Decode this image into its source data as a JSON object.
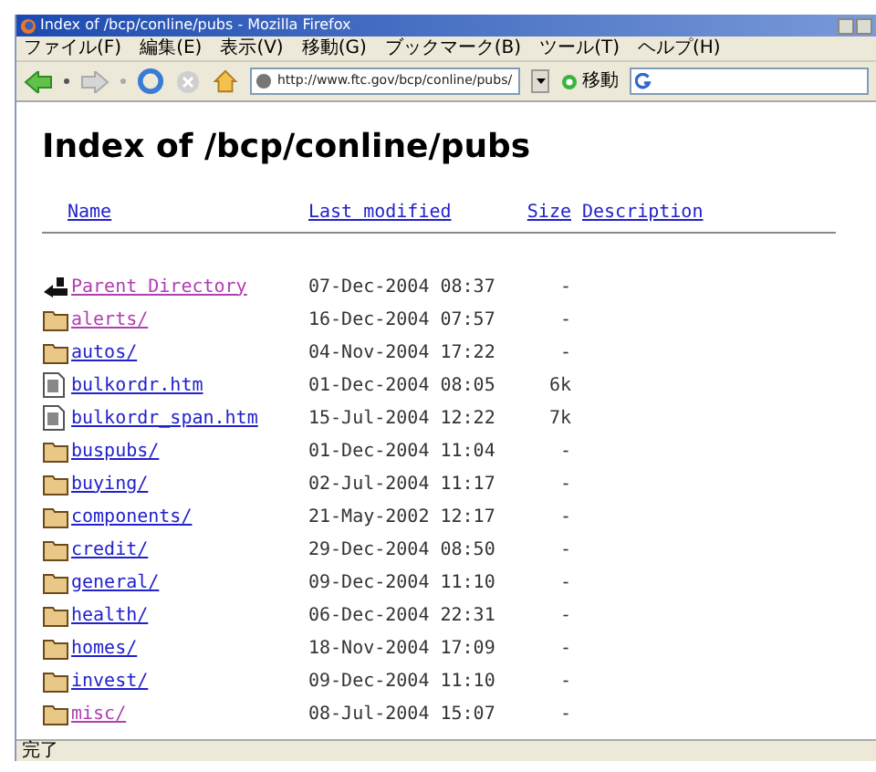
{
  "window": {
    "title": "Index of /bcp/conline/pubs - Mozilla Firefox"
  },
  "menu": [
    "ファイル(F)",
    "編集(E)",
    "表示(V)",
    "移動(G)",
    "ブックマーク(B)",
    "ツール(T)",
    "ヘルプ(H)"
  ],
  "toolbar": {
    "url": "http://www.ftc.gov/bcp/conline/pubs/",
    "go": "移動"
  },
  "heading": "Index of /bcp/conline/pubs",
  "columns": [
    "Name",
    "Last modified",
    "Size",
    "Description"
  ],
  "rows": [
    {
      "kind": "parent",
      "name": "Parent Directory",
      "modified": "07-Dec-2004 08:37",
      "size": "-",
      "visited": true
    },
    {
      "kind": "folder",
      "name": "alerts/",
      "modified": "16-Dec-2004 07:57",
      "size": "-",
      "visited": true
    },
    {
      "kind": "folder",
      "name": "autos/",
      "modified": "04-Nov-2004 17:22",
      "size": "-",
      "visited": false
    },
    {
      "kind": "file",
      "name": "bulkordr.htm",
      "modified": "01-Dec-2004 08:05",
      "size": "6k",
      "visited": false
    },
    {
      "kind": "file",
      "name": "bulkordr_span.htm",
      "modified": "15-Jul-2004 12:22",
      "size": "7k",
      "visited": false
    },
    {
      "kind": "folder",
      "name": "buspubs/",
      "modified": "01-Dec-2004 11:04",
      "size": "-",
      "visited": false
    },
    {
      "kind": "folder",
      "name": "buying/",
      "modified": "02-Jul-2004 11:17",
      "size": "-",
      "visited": false
    },
    {
      "kind": "folder",
      "name": "components/",
      "modified": "21-May-2002 12:17",
      "size": "-",
      "visited": false
    },
    {
      "kind": "folder",
      "name": "credit/",
      "modified": "29-Dec-2004 08:50",
      "size": "-",
      "visited": false
    },
    {
      "kind": "folder",
      "name": "general/",
      "modified": "09-Dec-2004 11:10",
      "size": "-",
      "visited": false
    },
    {
      "kind": "folder",
      "name": "health/",
      "modified": "06-Dec-2004 22:31",
      "size": "-",
      "visited": false
    },
    {
      "kind": "folder",
      "name": "homes/",
      "modified": "18-Nov-2004 17:09",
      "size": "-",
      "visited": false
    },
    {
      "kind": "folder",
      "name": "invest/",
      "modified": "09-Dec-2004 11:10",
      "size": "-",
      "visited": false
    },
    {
      "kind": "folder",
      "name": "misc/",
      "modified": "08-Jul-2004 15:07",
      "size": "-",
      "visited": true
    }
  ],
  "status_bar": "完了"
}
